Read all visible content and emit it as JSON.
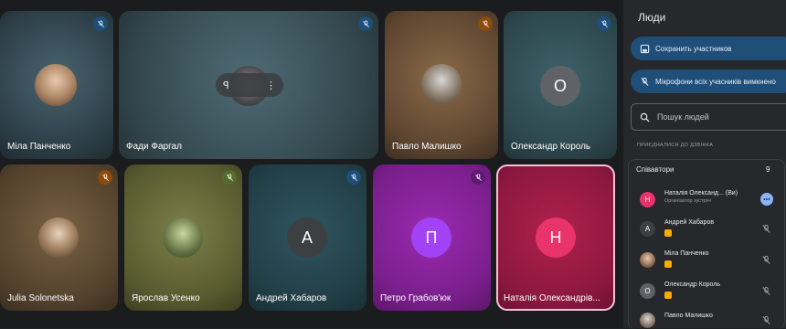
{
  "tiles": [
    {
      "name": "Міла Панченко",
      "mic": "#1f4e79"
    },
    {
      "name": "Фади Фаргал",
      "mic": "#1f4e79"
    },
    {
      "name": "Павло Малишко",
      "mic": "#8a4b0f"
    },
    {
      "name": "Олександр Король",
      "letter": "О",
      "mic": "#1f4e79"
    },
    {
      "name": "Julia Solonetska",
      "mic": "#8a4b0f"
    },
    {
      "name": "Ярослав Усенко",
      "mic": "#556b2f"
    },
    {
      "name": "Андрей Хабаров",
      "letter": "А",
      "mic": "#1f4e79"
    },
    {
      "name": "Петро Грабов'юк",
      "letter": "П",
      "mic": "#5e1a6e"
    },
    {
      "name": "Наталія Олександрів...",
      "letter": "Н",
      "mic": "#6b1030"
    }
  ],
  "panel": {
    "title": "Люди",
    "save_participants": "Сохранить участников",
    "mute_all": "Мікрофони всіх учасників вимкнено",
    "search_placeholder": "Пошук людей",
    "section_label": "ПРИЄДНАЛИСЯ ДО ДЗВІНКА",
    "group_title": "Співавтори",
    "group_count": "9",
    "participants": [
      {
        "letter": "Н",
        "name": "Наталія Олександ... (Ви)",
        "sub": "Організатор зустрічі",
        "color": "#e8336b"
      },
      {
        "letter": "А",
        "name": "Андрей Хабаров",
        "color": "#3c4043"
      },
      {
        "letter": "",
        "name": "Міла Панченко",
        "color": "#5f6368"
      },
      {
        "letter": "О",
        "name": "Олександр Король",
        "color": "#5f6368"
      },
      {
        "letter": "",
        "name": "Павло Малишко",
        "color": "#8a6a4b"
      }
    ]
  },
  "hoverbar": {
    "pin": "ꟼ",
    "more": "⋮"
  },
  "colors": {
    "accent": "#8ab4f8",
    "presenter_pill": "#1f4e79",
    "host": "#e8336b"
  }
}
